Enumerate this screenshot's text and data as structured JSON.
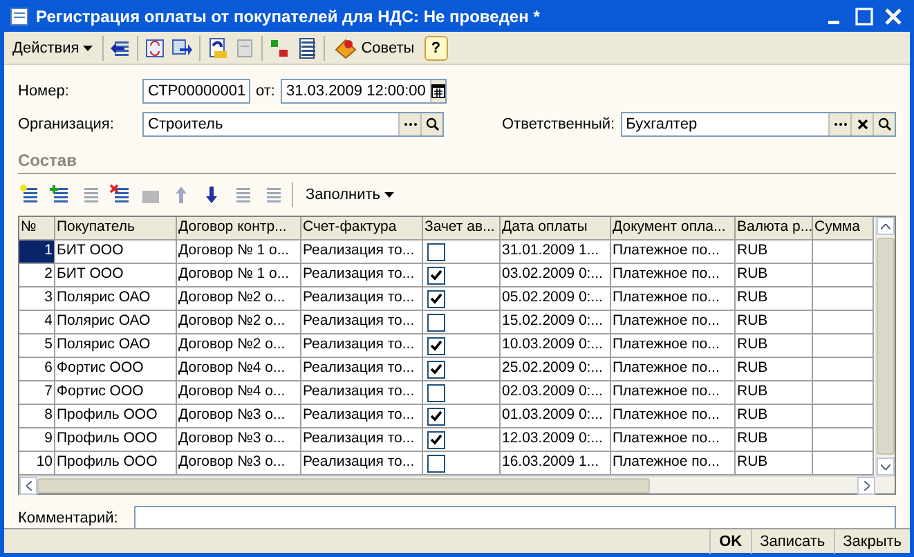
{
  "window": {
    "title": "Регистрация оплаты от покупателей для НДС: Не проведен *"
  },
  "toolbar": {
    "actions_menu": "Действия",
    "tips_button": "Советы",
    "help_button": "?"
  },
  "header": {
    "number_label": "Номер:",
    "number_value": "СТР00000001",
    "date_label": "от:",
    "date_value": "31.03.2009 12:00:00",
    "organization_label": "Организация:",
    "organization_value": "Строитель",
    "responsible_label": "Ответственный:",
    "responsible_value": "Бухгалтер"
  },
  "section": {
    "title": "Состав",
    "fill_menu": "Заполнить"
  },
  "table": {
    "columns": [
      "№",
      "Покупатель",
      "Договор контр...",
      "Счет-фактура",
      "Зачет ав...",
      "Дата оплаты",
      "Документ опла...",
      "Валюта р...",
      "Сумма"
    ],
    "rows": [
      {
        "n": "1",
        "buyer": "БИТ ООО",
        "contract": "Договор № 1 о...",
        "invoice": "Реализация то...",
        "checked": false,
        "date": "31.01.2009 1...",
        "document": "Платежное по...",
        "currency": "RUB",
        "selected": true
      },
      {
        "n": "2",
        "buyer": "БИТ ООО",
        "contract": "Договор № 1 о...",
        "invoice": "Реализация то...",
        "checked": true,
        "date": "03.02.2009 0:...",
        "document": "Платежное по...",
        "currency": "RUB",
        "selected": false
      },
      {
        "n": "3",
        "buyer": "Полярис ОАО",
        "contract": "Договор №2 о...",
        "invoice": "Реализация то...",
        "checked": true,
        "date": "05.02.2009 0:...",
        "document": "Платежное по...",
        "currency": "RUB",
        "selected": false
      },
      {
        "n": "4",
        "buyer": "Полярис ОАО",
        "contract": "Договор №2 о...",
        "invoice": "Реализация то...",
        "checked": false,
        "date": "15.02.2009 0:...",
        "document": "Платежное по...",
        "currency": "RUB",
        "selected": false
      },
      {
        "n": "5",
        "buyer": "Полярис ОАО",
        "contract": "Договор №2 о...",
        "invoice": "Реализация то...",
        "checked": true,
        "date": "10.03.2009 0:...",
        "document": "Платежное по...",
        "currency": "RUB",
        "selected": false
      },
      {
        "n": "6",
        "buyer": "Фортис ООО",
        "contract": "Договор №4 о...",
        "invoice": "Реализация то...",
        "checked": true,
        "date": "25.02.2009 0:...",
        "document": "Платежное по...",
        "currency": "RUB",
        "selected": false
      },
      {
        "n": "7",
        "buyer": "Фортис ООО",
        "contract": "Договор №4 о...",
        "invoice": "Реализация то...",
        "checked": false,
        "date": "02.03.2009 0:...",
        "document": "Платежное по...",
        "currency": "RUB",
        "selected": false
      },
      {
        "n": "8",
        "buyer": "Профиль ООО",
        "contract": "Договор №3 о...",
        "invoice": "Реализация то...",
        "checked": true,
        "date": "01.03.2009 0:...",
        "document": "Платежное по...",
        "currency": "RUB",
        "selected": false
      },
      {
        "n": "9",
        "buyer": "Профиль ООО",
        "contract": "Договор №3 о...",
        "invoice": "Реализация то...",
        "checked": true,
        "date": "12.03.2009 0:...",
        "document": "Платежное по...",
        "currency": "RUB",
        "selected": false
      },
      {
        "n": "10",
        "buyer": "Профиль ООО",
        "contract": "Договор №3 о...",
        "invoice": "Реализация то...",
        "checked": false,
        "date": "16.03.2009 1...",
        "document": "Платежное по...",
        "currency": "RUB",
        "selected": false
      }
    ]
  },
  "comment": {
    "label": "Комментарий:"
  },
  "buttons": [
    {
      "label": "OK",
      "kind": "default"
    },
    {
      "label": "Записать",
      "kind": "normal"
    },
    {
      "label": "Закрыть",
      "kind": "normal"
    }
  ]
}
